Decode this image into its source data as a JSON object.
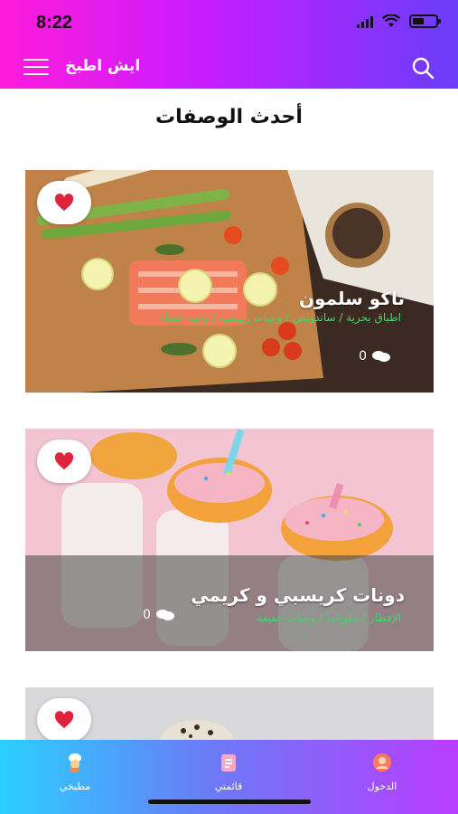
{
  "status": {
    "time": "8:22"
  },
  "header": {
    "app_title": "ايش اطبخ"
  },
  "section": {
    "title": "أحدث الوصفات"
  },
  "recipes": [
    {
      "title": "تاكو سلمون",
      "categories": "اطباق بحرية / ساندويش / وجبات رئيسية / وجبة عشاء",
      "comments": "0"
    },
    {
      "title": "دونات كريسبي و كريمي",
      "categories": "الإفطار / حلويات / وجبات خفيفة",
      "comments": "0"
    },
    {
      "title": "",
      "categories": "",
      "comments": ""
    }
  ],
  "tabs": [
    {
      "label": "مطبخي",
      "icon": "chef-icon"
    },
    {
      "label": "قائمتي",
      "icon": "list-icon"
    },
    {
      "label": "الدخول",
      "icon": "login-icon"
    }
  ],
  "colors": {
    "header_start": "#ff1bd9",
    "header_end": "#6a3df8",
    "category_green": "#44d36a",
    "heart_red": "#e0233d"
  }
}
